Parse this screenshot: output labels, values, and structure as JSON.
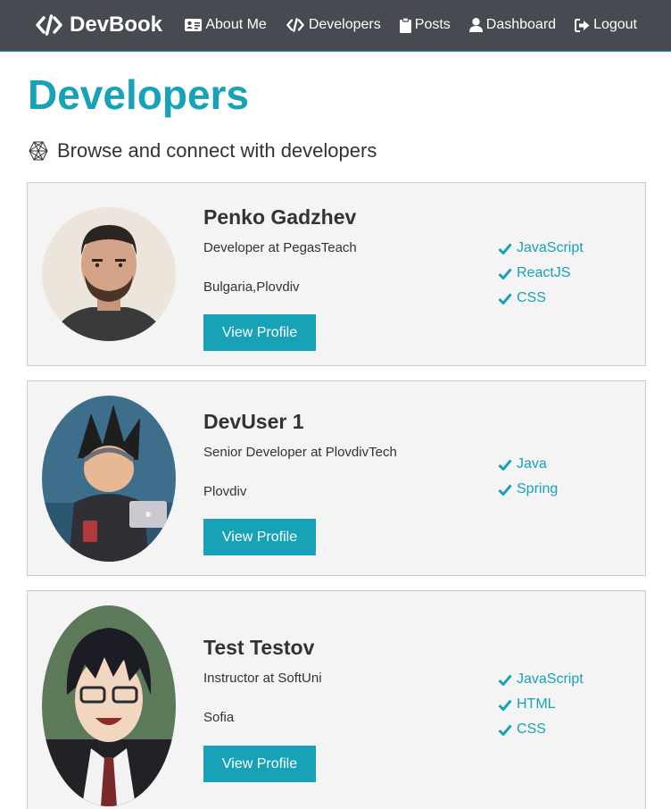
{
  "nav": {
    "brand": "DevBook",
    "links": [
      {
        "label": "About Me",
        "icon": "id-card-icon"
      },
      {
        "label": "Developers",
        "icon": "code-icon"
      },
      {
        "label": "Posts",
        "icon": "clipboard-icon"
      },
      {
        "label": "Dashboard",
        "icon": "user-icon"
      },
      {
        "label": "Logout",
        "icon": "sign-out-icon"
      }
    ]
  },
  "page": {
    "title": "Developers",
    "lead": "Browse and connect with developers",
    "lead_icon": "connectdevelop-icon"
  },
  "colors": {
    "accent": "#17a2b8",
    "navbar": "#474a50",
    "card": "#f4f4f4"
  },
  "profiles": [
    {
      "name": "Penko Gadzhev",
      "status": "Developer at PegasTeach",
      "location": "Bulgaria,Plovdiv",
      "button": "View Profile",
      "skills": [
        "JavaScript",
        "ReactJS",
        "CSS"
      ]
    },
    {
      "name": "DevUser 1",
      "status": "Senior Developer at PlovdivTech",
      "location": "Plovdiv",
      "button": "View Profile",
      "skills": [
        "Java",
        "Spring"
      ]
    },
    {
      "name": "Test Testov",
      "status": "Instructor at SoftUni",
      "location": "Sofia",
      "button": "View Profile",
      "skills": [
        "JavaScript",
        "HTML",
        "CSS"
      ]
    }
  ]
}
